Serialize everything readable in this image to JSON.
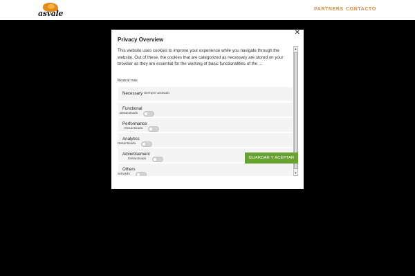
{
  "header": {
    "logo_text": "asvale",
    "nav": [
      {
        "label": "PARTNERS"
      },
      {
        "label": "CONTACTO"
      }
    ]
  },
  "modal": {
    "close_icon": "close-icon",
    "title": "Privacy Overview",
    "description": "This website uses cookies to improve your experience while you navigate through the website. Out of these, the cookies that are categorized as necessary are stored on your browser as they are essential for the working of basic functionalities of the ...",
    "show_more": "Mostrar más",
    "categories": [
      {
        "label": "Necessary",
        "status": "Siempre activado"
      },
      {
        "label": "Functional",
        "status": "Desactivado"
      },
      {
        "label": "Performance",
        "status": "Desactivado"
      },
      {
        "label": "Analytics",
        "status": "Desactivado"
      },
      {
        "label": "Advertisement",
        "status": "Desactivado"
      },
      {
        "label": "Others",
        "status": "activado"
      }
    ],
    "accept_button": "GUARDAR Y ACEPTAR"
  },
  "colors": {
    "accent_orange": "#e0893a",
    "accept_green": "#68a332",
    "overlay": "#000000"
  }
}
